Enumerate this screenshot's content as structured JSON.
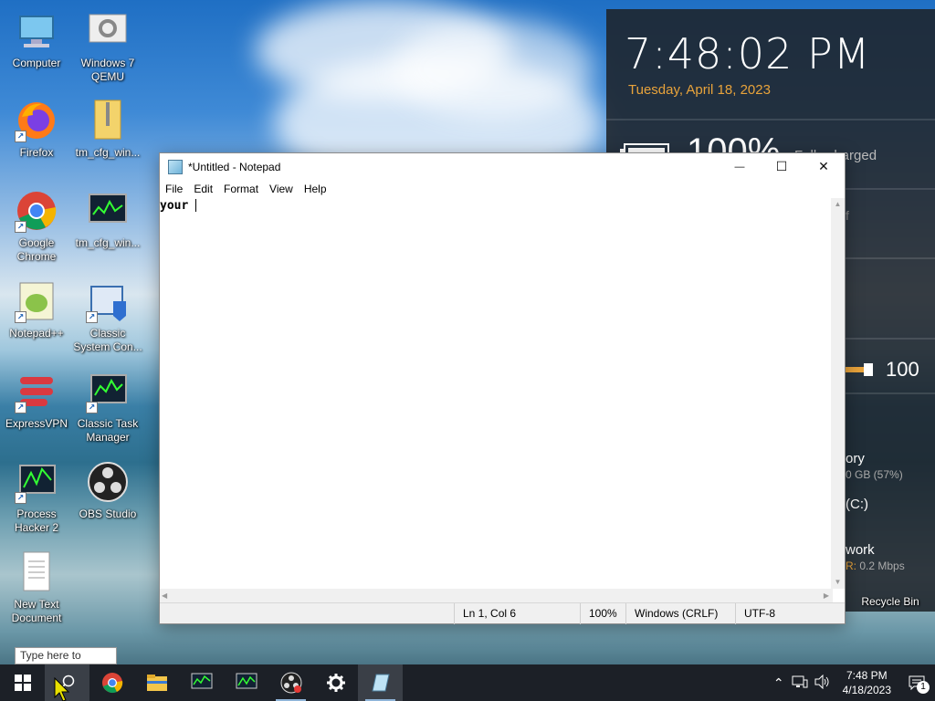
{
  "desktop": {
    "icons": [
      {
        "label": "Computer",
        "name": "computer"
      },
      {
        "label": "Windows 7 QEMU",
        "name": "windows7-qemu"
      },
      {
        "label": "Firefox",
        "name": "firefox"
      },
      {
        "label": "tm_cfg_win...",
        "name": "tm-cfg-zip"
      },
      {
        "label": "Google Chrome",
        "name": "google-chrome"
      },
      {
        "label": "tm_cfg_win...",
        "name": "tm-cfg-monitor"
      },
      {
        "label": "Notepad++",
        "name": "notepad-plus-plus"
      },
      {
        "label": "Classic System Con...",
        "name": "classic-system-config"
      },
      {
        "label": "ExpressVPN",
        "name": "expressvpn"
      },
      {
        "label": "Classic Task Manager",
        "name": "classic-task-manager"
      },
      {
        "label": "Process Hacker 2",
        "name": "process-hacker"
      },
      {
        "label": "OBS Studio",
        "name": "obs-studio"
      },
      {
        "label": "New Text Document",
        "name": "new-text-document"
      },
      {
        "label": "Recycle Bin",
        "name": "recycle-bin"
      }
    ]
  },
  "widget": {
    "time": "7:48:02 PM",
    "date": "Tuesday, April 18, 2023",
    "battery_percent": "100%",
    "battery_status": "Fully charged",
    "partial_text_1": "f",
    "volume_value": "100",
    "volume_level": 1.0,
    "memory_title": "ory",
    "memory_detail": "0 GB (57%)",
    "disk_title": "(C:)",
    "network_title": "work",
    "network_prefix": "R:",
    "network_detail": " 0.2 Mbps",
    "date_color": "#e8a33b"
  },
  "notepad": {
    "title": "*Untitled - Notepad",
    "menu": [
      "File",
      "Edit",
      "Format",
      "View",
      "Help"
    ],
    "content": "your ",
    "status": {
      "position": "Ln 1, Col 6",
      "zoom": "100%",
      "line_endings": "Windows (CRLF)",
      "encoding": "UTF-8"
    },
    "minimize_glyph": "—",
    "maximize_glyph": "☐",
    "close_glyph": "✕"
  },
  "search": {
    "placeholder": "Type here to search"
  },
  "taskbar": {
    "apps": [
      "start",
      "search",
      "chrome",
      "file-explorer",
      "task-manager",
      "classic-task-manager",
      "obs-studio",
      "settings",
      "notepad"
    ],
    "clock_time": "7:48 PM",
    "clock_date": "4/18/2023",
    "notification_count": "1"
  }
}
